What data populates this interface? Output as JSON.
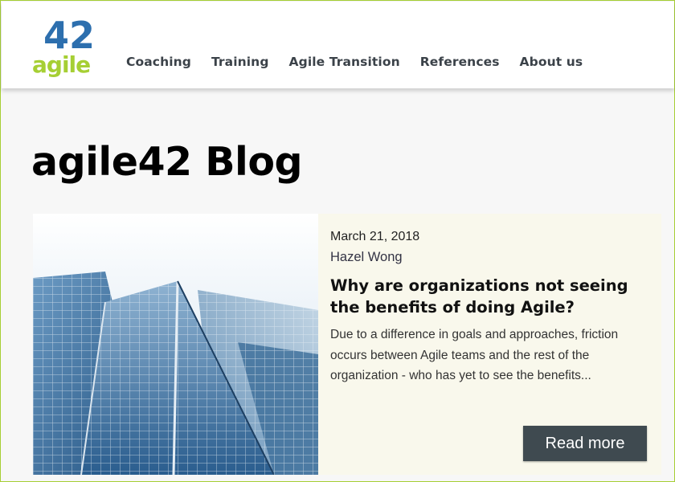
{
  "logo": {
    "number": "42",
    "word": "agile",
    "colors": {
      "blue": "#2d6fae",
      "green": "#a6cf34"
    }
  },
  "nav": {
    "items": [
      {
        "label": "Coaching"
      },
      {
        "label": "Training"
      },
      {
        "label": "Agile Transition"
      },
      {
        "label": "References"
      },
      {
        "label": "About us"
      }
    ]
  },
  "page": {
    "title": "agile42 Blog"
  },
  "post": {
    "date": "March 21, 2018",
    "author": "Hazel Wong",
    "title": "Why are organizations not seeing the benefits of doing Agile?",
    "excerpt": "Due to a difference in goals and approaches, friction occurs between Agile teams and the rest of the organization - who has yet to see the benefits...",
    "read_more_label": "Read more",
    "image": "glass-skyscraper-photo"
  },
  "colors": {
    "accent_border": "#a6cf34",
    "button_bg": "#3f4a50",
    "panel_bg": "#f9f8ec",
    "nav_text": "#3b4249"
  }
}
